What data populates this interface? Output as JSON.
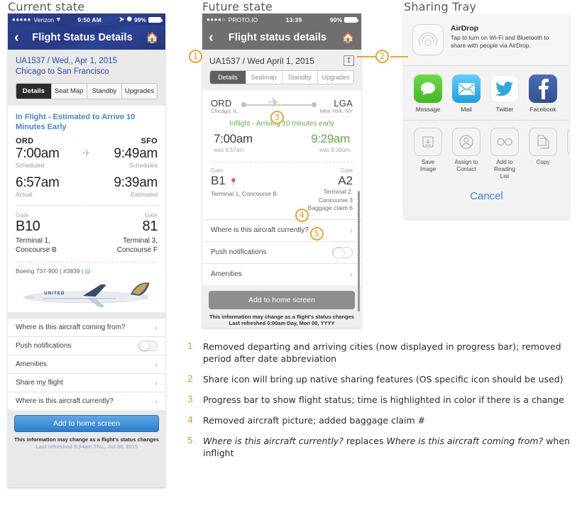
{
  "captions": {
    "current": "Current state",
    "future": "Future state",
    "tray": "Sharing Tray"
  },
  "current_phone": {
    "status_bar": {
      "signal": "●●●●●",
      "carrier": "Verizon",
      "wifi_icon": "wifi-icon",
      "time": "9:50 AM",
      "location_icon": "location-arrow-icon",
      "bluetooth_icon": "bluetooth-icon",
      "battery": "99%"
    },
    "navbar": {
      "back_icon": "chevron-left-icon",
      "title": "Flight Status Details",
      "home_icon": "home-icon"
    },
    "flight_line_1": "UA1537 / Wed., Apr 1, 2015",
    "flight_line_2": "Chicago to San Francisco",
    "tabs": [
      {
        "label": "Details",
        "active": true
      },
      {
        "label": "Seat Map",
        "active": false
      },
      {
        "label": "Standby",
        "active": false
      },
      {
        "label": "Upgrades",
        "active": false
      }
    ],
    "status_text": "In Flight - Estimated to Arrive 10 Minutes Early",
    "depart": {
      "airport": "ORD",
      "time_primary": "7:00am",
      "label_primary": "Scheduled",
      "time_secondary": "6:57am",
      "label_secondary": "Actual",
      "gate_label": "Gate",
      "gate": "B10",
      "terminal": "Terminal 1, Concourse B"
    },
    "arrive": {
      "airport": "SFO",
      "time_primary": "9:49am",
      "label_primary": "Scheduled",
      "time_secondary": "9:39am",
      "label_secondary": "Estimated",
      "gate_label": "Gate",
      "gate": "81",
      "terminal": "Terminal 3, Concourse F"
    },
    "aircraft_line": "Boeing 737-900 | #3839 |",
    "aircraft_image_alt": "united-airplane-photo",
    "rows": [
      {
        "label": "Where is this aircraft coming from?",
        "type": "chevron"
      },
      {
        "label": "Push notifications",
        "type": "toggle"
      },
      {
        "label": "Amenities",
        "type": "chevron"
      },
      {
        "label": "Share my flight",
        "type": "chevron"
      },
      {
        "label": "Where is this aircraft currently?",
        "type": "chevron"
      }
    ],
    "cta_label": "Add to home screen",
    "footnote_main": "This information may change as a flight's status changes",
    "footnote_sub": "Last refreshed 9:54am Thu., Jul 30, 2015"
  },
  "future_phone": {
    "status_bar": {
      "signal": "●●●●○",
      "carrier": "PROTO.IO",
      "time": "13:39",
      "battery": "90%"
    },
    "navbar": {
      "back_icon": "chevron-left-icon",
      "title": "Flight status details",
      "home_icon": "home-icon"
    },
    "flight_line": "UA1537 / Wed April 1, 2015",
    "share_icon": "share-up-arrow-icon",
    "tabs": [
      {
        "label": "Details",
        "active": true
      },
      {
        "label": "Seatmap",
        "active": false
      },
      {
        "label": "Standby",
        "active": false
      },
      {
        "label": "Upgrades",
        "active": false
      }
    ],
    "progress": {
      "origin_code": "ORD",
      "origin_city": "Chicago, IL",
      "dest_code": "LGA",
      "dest_city": "New York, NY",
      "plane_icon": "airplane-icon"
    },
    "inflight_status": "Inflight - Arriving 10 minutes early",
    "depart": {
      "time": "7:00am",
      "was": "was 6:57am",
      "gate_label": "Gate",
      "gate": "B1",
      "pin_icon": "map-pin-icon",
      "terminal": "Terminal 1, Concourse B"
    },
    "arrive": {
      "time": "9:29am",
      "was": "was 9:39am",
      "gate_label": "Gate",
      "gate": "A2",
      "terminal_line_1": "Terminal 2,",
      "terminal_line_2": "Concourse 3",
      "terminal_line_3": "Baggage claim 6"
    },
    "rows": [
      {
        "label": "Where is this aircraft currently?",
        "type": "chevron"
      },
      {
        "label": "Push notifications",
        "type": "toggle"
      },
      {
        "label": "Amenities",
        "type": "chevron"
      }
    ],
    "cta_label": "Add to home screen",
    "footnote_main": "This information may change as a flight's status changes",
    "footnote_sub": "Last refreshed 0:00am Day, Mon 00, YYYY"
  },
  "sharing_tray": {
    "airdrop": {
      "icon": "airdrop-icon",
      "title": "AirDrop",
      "description": "Tap to turn on Wi-Fi and Bluetooth to share with people via AirDrop."
    },
    "apps": [
      {
        "label": "Message",
        "icon": "message-bubble-icon",
        "color": "#5bc236"
      },
      {
        "label": "Mail",
        "icon": "envelope-icon",
        "color": "#2aa8e8"
      },
      {
        "label": "Twitter",
        "icon": "twitter-bird-icon",
        "color": "#ffffff"
      },
      {
        "label": "Facebook",
        "icon": "facebook-f-icon",
        "color": "#3b5998"
      }
    ],
    "actions": [
      {
        "label": "Save Image",
        "icon": "save-download-icon"
      },
      {
        "label": "Assign to Contact",
        "icon": "contact-person-icon"
      },
      {
        "label": "Add to Reading List",
        "icon": "glasses-icon"
      },
      {
        "label": "Copy",
        "icon": "copy-pages-icon"
      }
    ],
    "cancel_label": "Cancel"
  },
  "markers": [
    "1",
    "2",
    "3",
    "4",
    "5"
  ],
  "notes": [
    {
      "n": "1",
      "text": "Removed departing and arriving cities (now displayed in progress bar); removed period after date abbreviation"
    },
    {
      "n": "2",
      "text": "Share icon will bring up native sharing features (OS specific icon should be used)"
    },
    {
      "n": "3",
      "text": "Progress bar to show flight status; time is highlighted in color if there is a change"
    },
    {
      "n": "4",
      "text": "Removed aircraft picture; added baggage claim #"
    },
    {
      "n": "5",
      "text": "Where is this aircraft currently? replaces Where is this aircraft coming from? when inflight"
    }
  ],
  "colors": {
    "accent_orange": "#f0a22e",
    "united_blue": "#2b3f8f",
    "link_blue": "#2f4aa8",
    "status_blue": "#4b84c9",
    "inflight_green": "#6aa84f",
    "future_grey": "#6f6f6f"
  }
}
